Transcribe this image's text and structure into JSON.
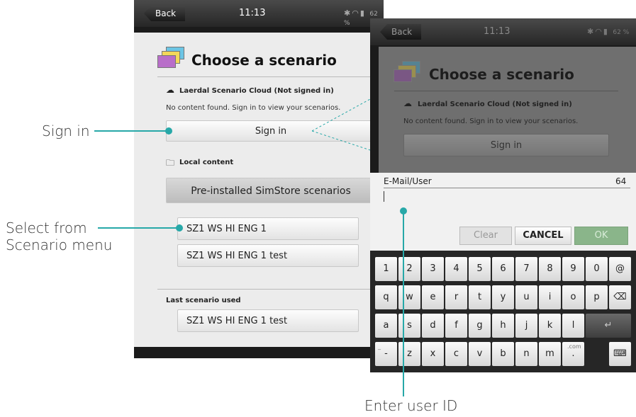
{
  "device1": {
    "back_label": "Back",
    "time": "11:13",
    "battery": "62 %",
    "title": "Choose a scenario",
    "cloud_label": "Laerdal Scenario Cloud (Not signed in)",
    "cloud_note": "No content found. Sign in to view your scenarios.",
    "sign_in": "Sign in",
    "local_label": "Local content",
    "preinstalled": "Pre-installed SimStore scenarios",
    "scenarios": [
      "SZ1 WS HI ENG 1",
      "SZ1 WS HI ENG 1 test"
    ],
    "last_used_label": "Last scenario used",
    "last_used": "SZ1 WS HI ENG 1 test"
  },
  "device2": {
    "back_label": "Back",
    "time": "11:13",
    "battery": "62 %",
    "title": "Choose a scenario",
    "cloud_label": "Laerdal Scenario Cloud (Not signed in)",
    "cloud_note": "No content found. Sign in to view your scenarios.",
    "sign_in": "Sign in",
    "dialog": {
      "field_label": "E-Mail/User",
      "char_count": "64",
      "clear": "Clear",
      "cancel": "CANCEL",
      "ok": "OK"
    },
    "keyboard": {
      "row1": [
        "1",
        "2",
        "3",
        "4",
        "5",
        "6",
        "7",
        "8",
        "9",
        "0",
        "@"
      ],
      "row2": [
        "q",
        "w",
        "e",
        "r",
        "t",
        "y",
        "u",
        "i",
        "o",
        "p"
      ],
      "row3": [
        "a",
        "s",
        "d",
        "f",
        "g",
        "h",
        "j",
        "k",
        "l"
      ],
      "row4": [
        "-",
        "z",
        "x",
        "c",
        "v",
        "b",
        "n",
        "m",
        "."
      ],
      "dotcom_hint": ".com",
      "dash_hint": "_"
    }
  },
  "callouts": {
    "sign_in": "Sign in",
    "select_line1": "Select from",
    "select_line2": "Scenario menu",
    "enter_user": "Enter user ID"
  },
  "colors": {
    "accent": "#27a8a8"
  }
}
